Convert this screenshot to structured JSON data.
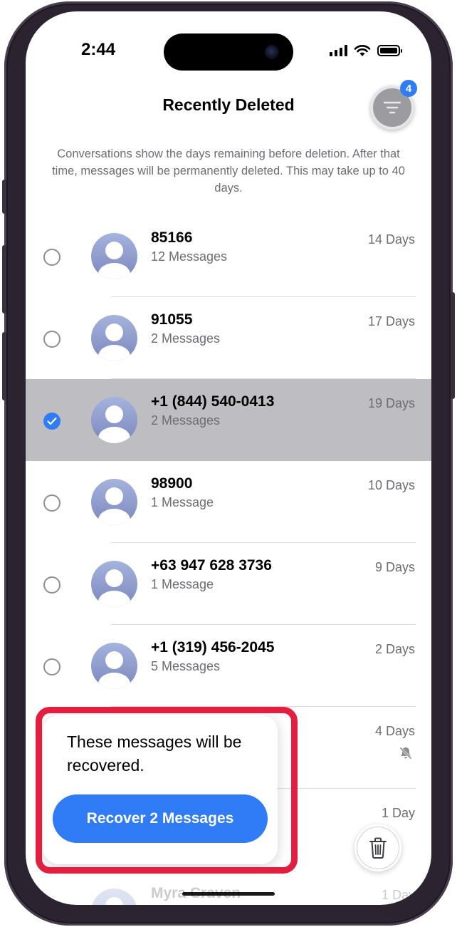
{
  "status_bar": {
    "time": "2:44"
  },
  "header": {
    "title": "Recently Deleted",
    "filter_badge": "4"
  },
  "description": "Conversations show the days remaining before deletion. After that time, messages will be permanently deleted. This may take up to 40 days.",
  "conversations": [
    {
      "name": "85166",
      "subtitle": "12 Messages",
      "days": "14 Days",
      "selected": false
    },
    {
      "name": "91055",
      "subtitle": "2 Messages",
      "days": "17 Days",
      "selected": false
    },
    {
      "name": "+1 (844) 540-0413",
      "subtitle": "2 Messages",
      "days": "19 Days",
      "selected": true
    },
    {
      "name": "98900",
      "subtitle": "1 Message",
      "days": "10 Days",
      "selected": false
    },
    {
      "name": "+63 947 628 3736",
      "subtitle": "1 Message",
      "days": "9 Days",
      "selected": false
    },
    {
      "name": "+1 (319) 456-2045",
      "subtitle": "5 Messages",
      "days": "2 Days",
      "selected": false
    },
    {
      "name": "",
      "subtitle": "",
      "days": "4 Days",
      "selected": false,
      "muted": true
    },
    {
      "name": "",
      "subtitle": "",
      "days": "1 Day",
      "selected": false
    },
    {
      "name": "Myra Craven",
      "subtitle": "",
      "days": "1 Day",
      "selected": false
    }
  ],
  "popover": {
    "message": "These messages will be recovered.",
    "button_label": "Recover 2 Messages"
  },
  "icons": {
    "filter": "filter-lines-icon",
    "trash": "trash-icon",
    "mute": "bell-slash-icon",
    "check": "checkmark-icon"
  },
  "colors": {
    "accent": "#2f7cf6",
    "selected_row": "#bdbdc2",
    "highlight": "#e41e3f"
  }
}
